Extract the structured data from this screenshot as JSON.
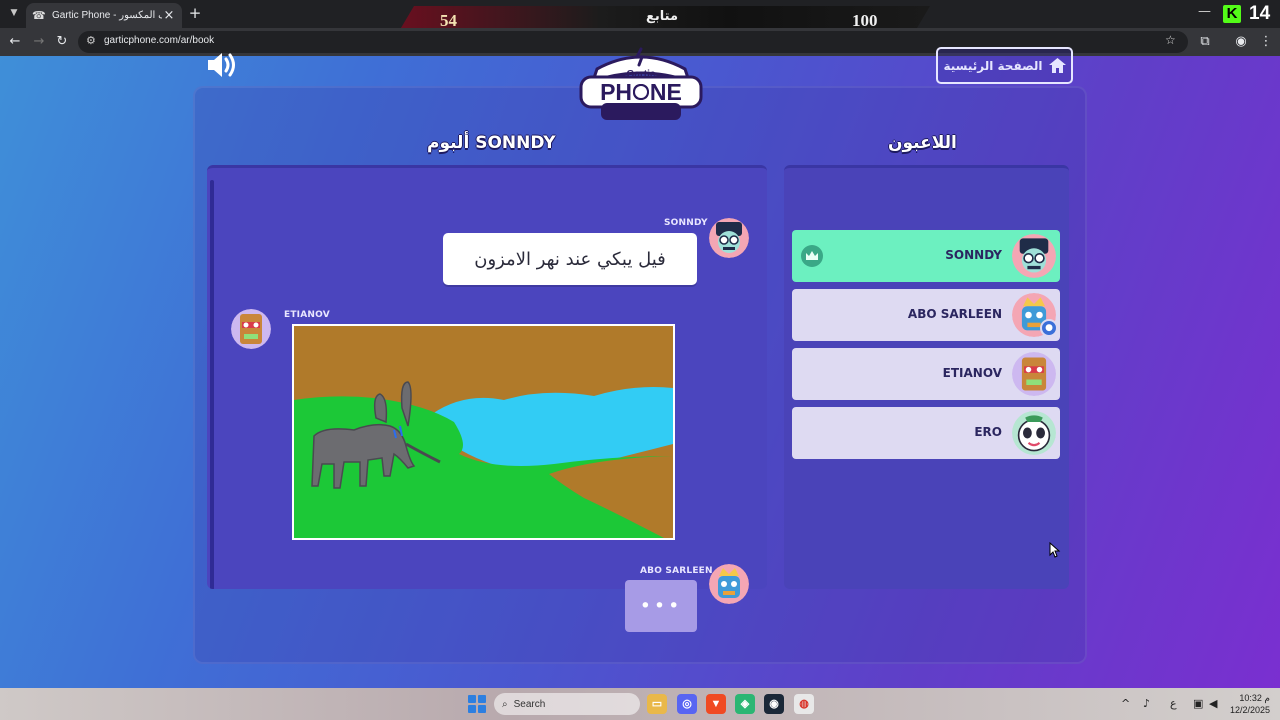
{
  "browser": {
    "tab_title": "Gartic Phone - الهاتف المكسور",
    "url": "garticphone.com/ar/book"
  },
  "overlay": {
    "score_left": "54",
    "score_center": "متابع",
    "score_right": "100",
    "kick_count": "14"
  },
  "game": {
    "home_button": "الصفحة الرئيسية",
    "album_title": "ألبوم SONNDY",
    "players_title": "اللاعبون",
    "album": {
      "entries": [
        {
          "author": "SONNDY",
          "type": "text",
          "text": "فيل يبكي عند نهر الامزون"
        },
        {
          "author": "ETIANOV",
          "type": "drawing",
          "drawing_alt": "elephant-by-river-drawing"
        },
        {
          "author": "ABO SARLEEN",
          "type": "typing",
          "text": "•••"
        }
      ]
    },
    "players": [
      {
        "name": "SONNDY",
        "active": true,
        "badge": "crown"
      },
      {
        "name": "ABO SARLEEN",
        "active": false,
        "badge": "host"
      },
      {
        "name": "ETIANOV",
        "active": false,
        "badge": ""
      },
      {
        "name": "ERO",
        "active": false,
        "badge": ""
      }
    ]
  },
  "taskbar": {
    "search_placeholder": "Search",
    "time": "10:32 م",
    "date": "12/2/2025",
    "lang": "ع"
  },
  "colors": {
    "active_player": "#6cf0c0",
    "panel": "#4b45be",
    "page_gradient_start": "#3f8fd8",
    "page_gradient_end": "#7a2fd0"
  }
}
